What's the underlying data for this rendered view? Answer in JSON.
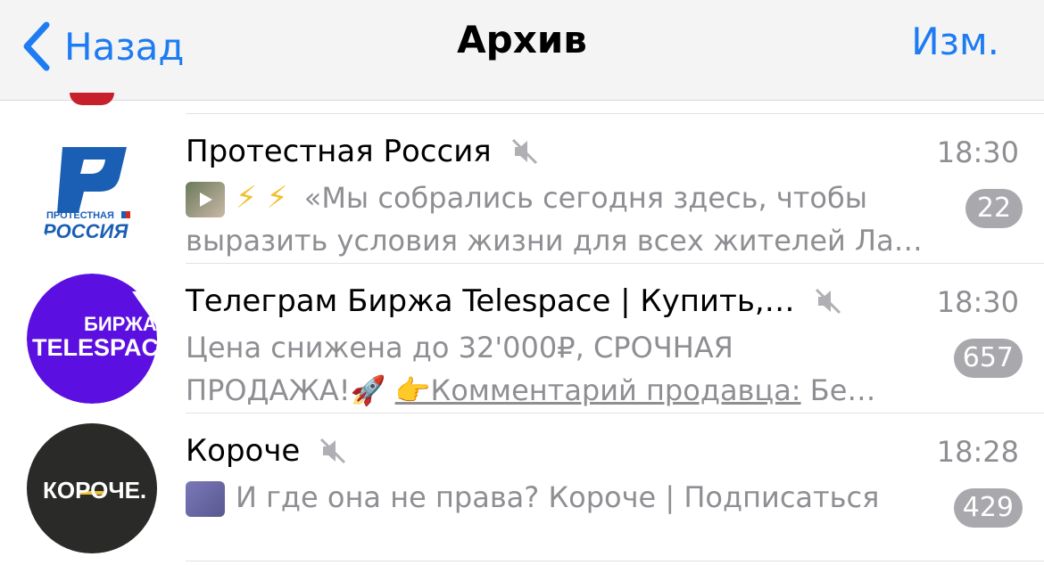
{
  "navbar": {
    "back_label": "Назад",
    "title": "Архив",
    "edit_label": "Изм."
  },
  "chats": [
    {
      "name": "Протестная Россия",
      "time": "18:30",
      "muted": true,
      "unread": "22",
      "preview_icons": "⚡ ⚡",
      "preview_line1": "«Мы собрались сегодня здесь, чтобы",
      "preview_line2": "выразить условия жизни для всех жителей Ла…",
      "avatar_text_top": "ПРОТЕСТНАЯ",
      "avatar_text_bottom": "РОССИЯ"
    },
    {
      "name": "Телеграм Биржа Telespace | Купить,…",
      "time": "18:30",
      "muted": true,
      "unread": "657",
      "preview_line1": "Цена снижена до 32'000₽, СРОЧНАЯ",
      "preview_line2_a": "ПРОДАЖА!🚀 ",
      "preview_line2_b": "👉Комментарий продавца:",
      "preview_line2_c": " Бе…",
      "avatar_text_top": "БИРЖА",
      "avatar_text_bottom": "TELESPACE"
    },
    {
      "name": "Короче",
      "time": "18:28",
      "muted": true,
      "unread": "429",
      "preview_line1": "И где она не права? Короче | Подписаться",
      "avatar_text": "КОРОЧЕ."
    }
  ],
  "colors": {
    "accent": "#1e7cf2",
    "badge": "#a9a9ad",
    "secondary_text": "#8e8e93",
    "telespace_purple": "#5b0fe0",
    "protest_blue": "#1a5fb4"
  }
}
